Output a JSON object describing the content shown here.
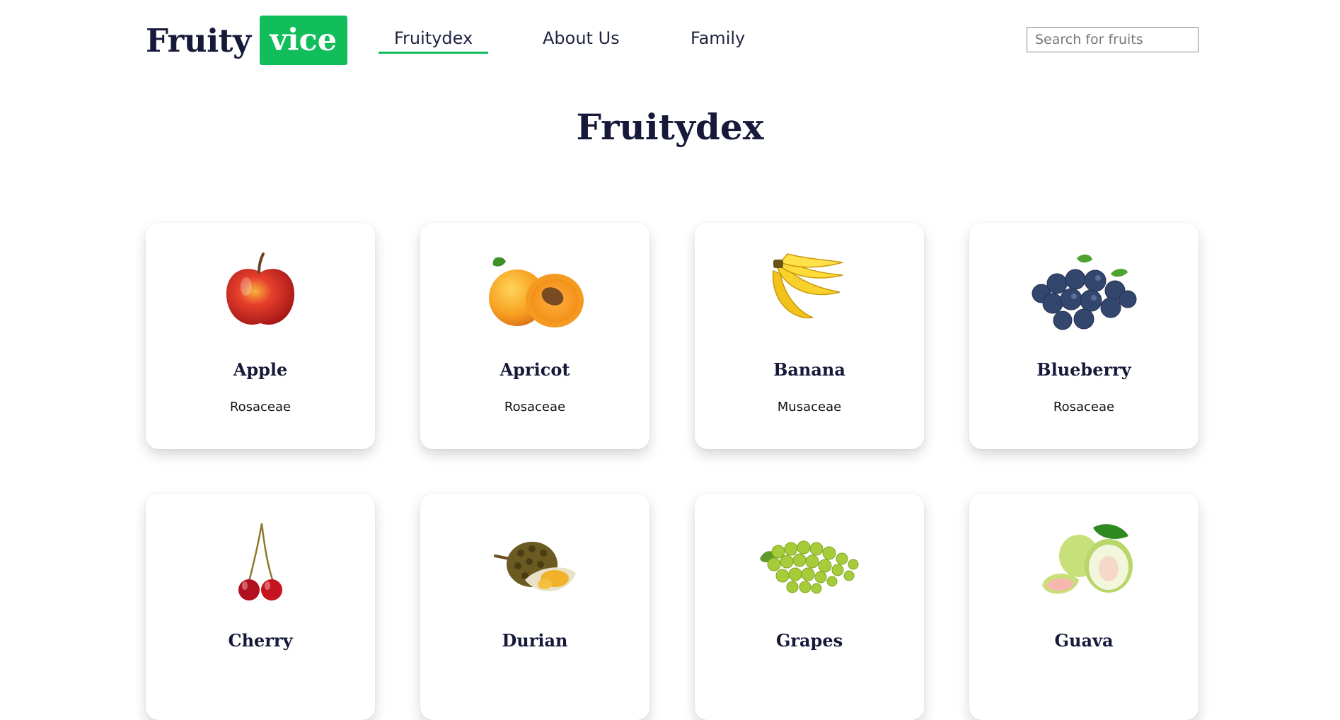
{
  "brand": {
    "part1": "Fruity",
    "part2": "vice",
    "accent": "#12bd5c",
    "text_color": "#16193a"
  },
  "nav": {
    "items": [
      {
        "label": "Fruitydex",
        "active": true
      },
      {
        "label": "About Us",
        "active": false
      },
      {
        "label": "Family",
        "active": false
      }
    ]
  },
  "search": {
    "placeholder": "Search for fruits",
    "value": ""
  },
  "page": {
    "title": "Fruitydex"
  },
  "fruits": [
    {
      "name": "Apple",
      "family": "Rosaceae",
      "icon": "apple-icon"
    },
    {
      "name": "Apricot",
      "family": "Rosaceae",
      "icon": "apricot-icon"
    },
    {
      "name": "Banana",
      "family": "Musaceae",
      "icon": "banana-icon"
    },
    {
      "name": "Blueberry",
      "family": "Rosaceae",
      "icon": "blueberry-icon"
    },
    {
      "name": "Cherry",
      "family": "",
      "icon": "cherry-icon"
    },
    {
      "name": "Durian",
      "family": "",
      "icon": "durian-icon"
    },
    {
      "name": "Grapes",
      "family": "",
      "icon": "grapes-icon"
    },
    {
      "name": "Guava",
      "family": "",
      "icon": "guava-icon"
    }
  ]
}
